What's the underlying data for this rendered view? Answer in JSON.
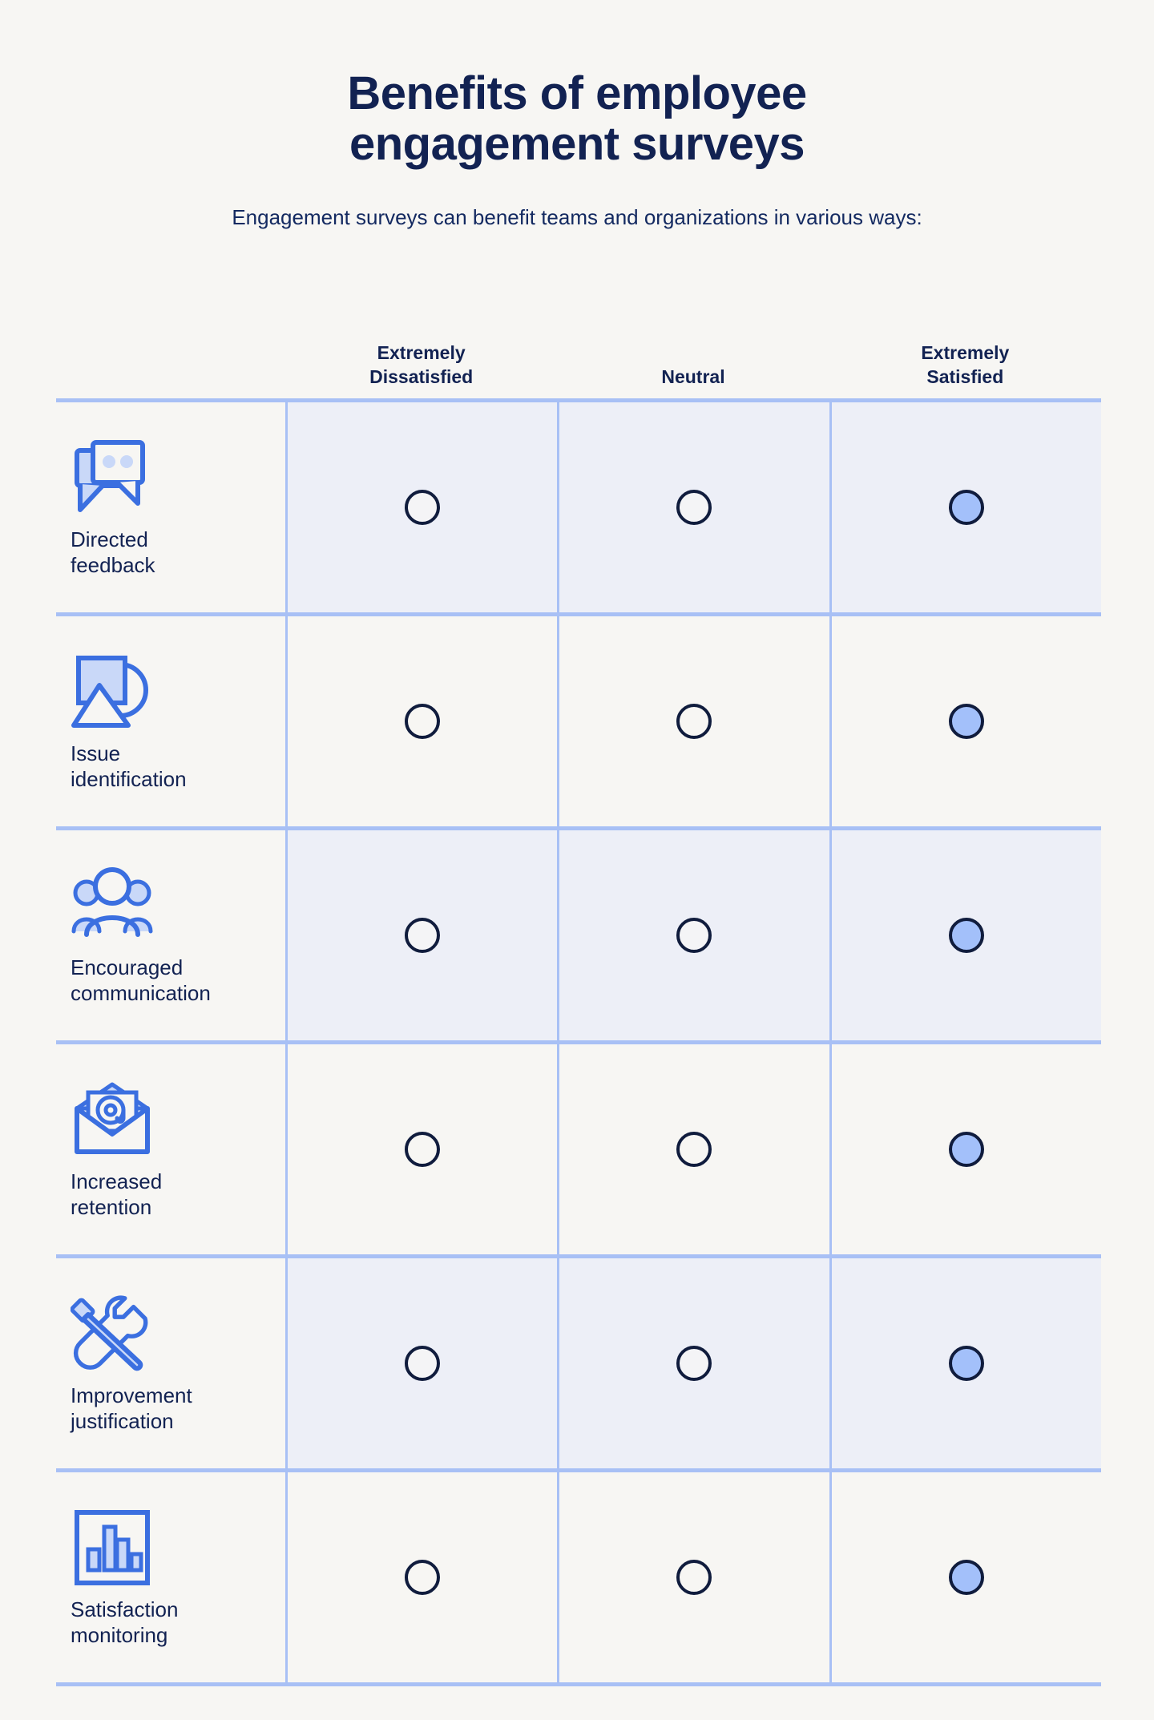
{
  "header": {
    "title_line1": "Benefits of employee",
    "title_line2": "engagement surveys",
    "subtitle": "Engagement surveys can benefit teams and organizations in various ways:"
  },
  "colors": {
    "background": "#f7f6f3",
    "navy": "#122252",
    "accent_blue": "#3b6fe0",
    "selected_fill": "#a3c0fa",
    "rule": "#a8c0f5",
    "tinted_row": "#edeff7"
  },
  "columns": [
    {
      "label_line1": "Extremely",
      "label_line2": "Dissatisfied",
      "key": "extremely-dissatisfied"
    },
    {
      "label_line1": "Neutral",
      "label_line2": "",
      "key": "neutral"
    },
    {
      "label_line1": "Extremely",
      "label_line2": "Satisfied",
      "key": "extremely-satisfied"
    }
  ],
  "rows": [
    {
      "icon": "chat-bubbles-icon",
      "label_line1": "Directed",
      "label_line2": "feedback",
      "selected_index": 2,
      "tinted": true
    },
    {
      "icon": "shapes-issue-icon",
      "label_line1": "Issue",
      "label_line2": "identification",
      "selected_index": 2,
      "tinted": false
    },
    {
      "icon": "people-group-icon",
      "label_line1": "Encouraged",
      "label_line2": "communication",
      "selected_index": 2,
      "tinted": true
    },
    {
      "icon": "email-envelope-icon",
      "label_line1": "Increased",
      "label_line2": "retention",
      "selected_index": 2,
      "tinted": false
    },
    {
      "icon": "wrench-screwdriver-icon",
      "label_line1": "Improvement",
      "label_line2": "justification",
      "selected_index": 2,
      "tinted": true
    },
    {
      "icon": "bar-chart-icon",
      "label_line1": "Satisfaction",
      "label_line2": "monitoring",
      "selected_index": 2,
      "tinted": false
    }
  ]
}
